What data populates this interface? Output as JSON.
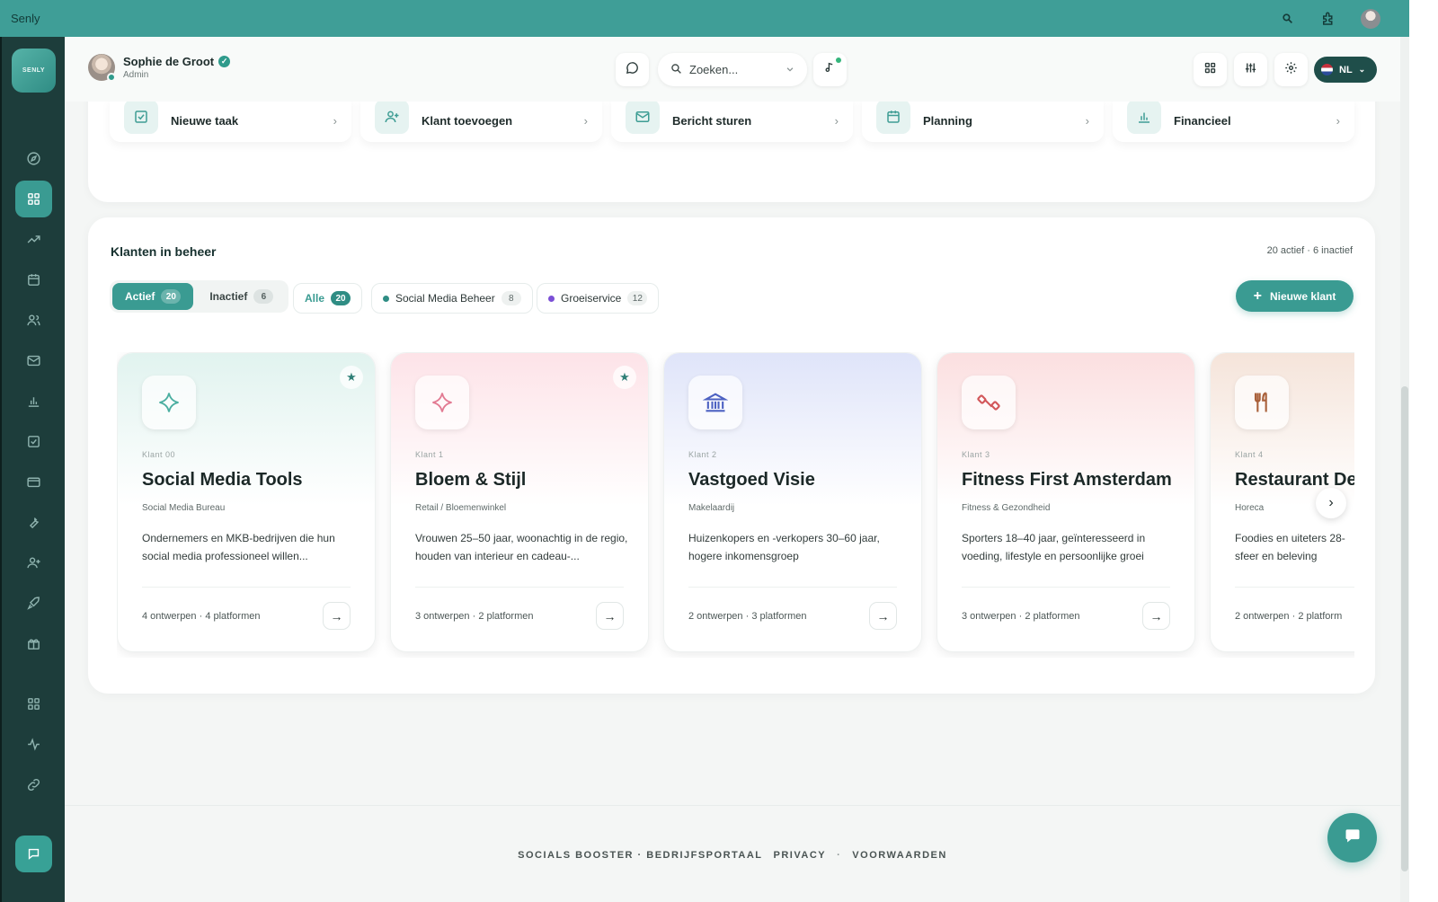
{
  "browser": {
    "title": "Senly"
  },
  "logo": {
    "text": "SENLY"
  },
  "header": {
    "user": {
      "name": "Sophie de Groot",
      "role": "Admin"
    },
    "search": {
      "placeholder": "Zoeken..."
    },
    "language": "NL"
  },
  "quick_actions": [
    {
      "label": "Nieuwe taak",
      "icon": "task-check-icon"
    },
    {
      "label": "Klant toevoegen",
      "icon": "user-add-icon"
    },
    {
      "label": "Bericht sturen",
      "icon": "mail-icon"
    },
    {
      "label": "Planning",
      "icon": "calendar-icon"
    },
    {
      "label": "Financieel",
      "icon": "bar-chart-icon"
    }
  ],
  "clients": {
    "title": "Klanten in beheer",
    "summary": "20 actief · 6 inactief",
    "segment": [
      {
        "label": "Actief",
        "count": "20"
      },
      {
        "label": "Inactief",
        "count": "6"
      }
    ],
    "filters": [
      {
        "label": "Alle",
        "count": "20"
      },
      {
        "label": "Social Media Beheer",
        "count": "8",
        "color": "#2f8d84"
      },
      {
        "label": "Groeiservice",
        "count": "12",
        "color": "#7b4fd6"
      }
    ],
    "new_button": "Nieuwe klant",
    "cards": [
      {
        "tag": "Klant 00",
        "name": "Social Media Tools",
        "category": "Social Media Bureau",
        "description": "Ondernemers en MKB-bedrijven die hun social media professioneel willen...",
        "meta": "4 ontwerpen · 4 platformen",
        "icon": "sparkle-icon",
        "accent": "#4aaea0",
        "starred": true
      },
      {
        "tag": "Klant 1",
        "name": "Bloem & Stijl",
        "category": "Retail / Bloemenwinkel",
        "description": "Vrouwen 25–50 jaar, woonachtig in de regio, houden van interieur en cadeau-...",
        "meta": "3 ontwerpen · 2 platformen",
        "icon": "sparkle-icon",
        "accent": "#e27a92",
        "starred": true
      },
      {
        "tag": "Klant 2",
        "name": "Vastgoed Visie",
        "category": "Makelaardij",
        "description": "Huizenkopers en -verkopers 30–60 jaar, hogere inkomensgroep",
        "meta": "2 ontwerpen · 3 platformen",
        "icon": "bank-icon",
        "accent": "#4c61c2",
        "starred": false
      },
      {
        "tag": "Klant 3",
        "name": "Fitness First Amsterdam",
        "category": "Fitness & Gezondheid",
        "description": "Sporters 18–40 jaar, geïnteresseerd in voeding, lifestyle en persoonlijke groei",
        "meta": "3 ontwerpen · 2 platformen",
        "icon": "dumbbell-icon",
        "accent": "#d2575a",
        "starred": false
      },
      {
        "tag": "Klant 4",
        "name": "Restaurant De T",
        "category": "Horeca",
        "description": "Foodies en uiteters 28- sfeer en beleving",
        "meta": "2 ontwerpen · 2 platform",
        "icon": "fork-knife-icon",
        "accent": "#a9603a",
        "starred": false
      }
    ]
  },
  "footer": {
    "brand": "SOCIALS BOOSTER · BEDRIJFSPORTAAL",
    "privacy": "PRIVACY",
    "separator": "·",
    "terms": "VOORWAARDEN"
  }
}
